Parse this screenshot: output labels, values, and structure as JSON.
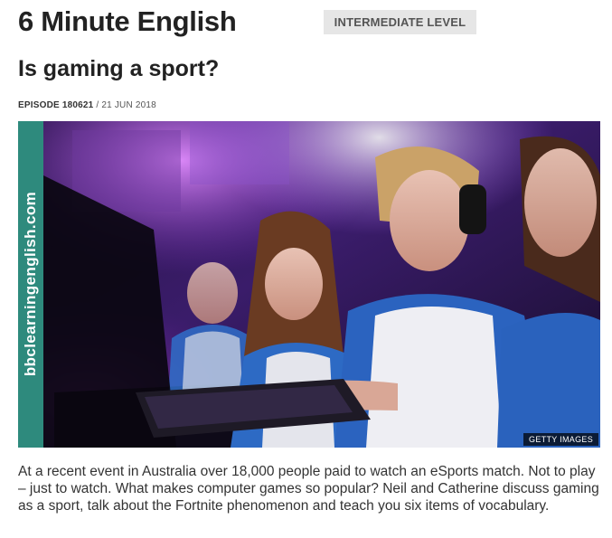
{
  "header": {
    "series_title": "6 Minute English",
    "level_badge": "INTERMEDIATE LEVEL"
  },
  "episode": {
    "title": "Is gaming a sport?",
    "number": "EPISODE 180621",
    "separator": " / ",
    "date": "21 JUN 2018"
  },
  "hero_image": {
    "side_text": "bbclearningenglish.com",
    "credit": "GETTY IMAGES",
    "strip_color": "#2e8a7d"
  },
  "intro": {
    "text": "At a recent event in Australia over 18,000 people paid to watch an eSports match. Not to play – just to watch. What makes computer games so popular? Neil and Catherine discuss gaming as a sport, talk about the Fortnite phenomenon and teach you six items of vocabulary."
  }
}
